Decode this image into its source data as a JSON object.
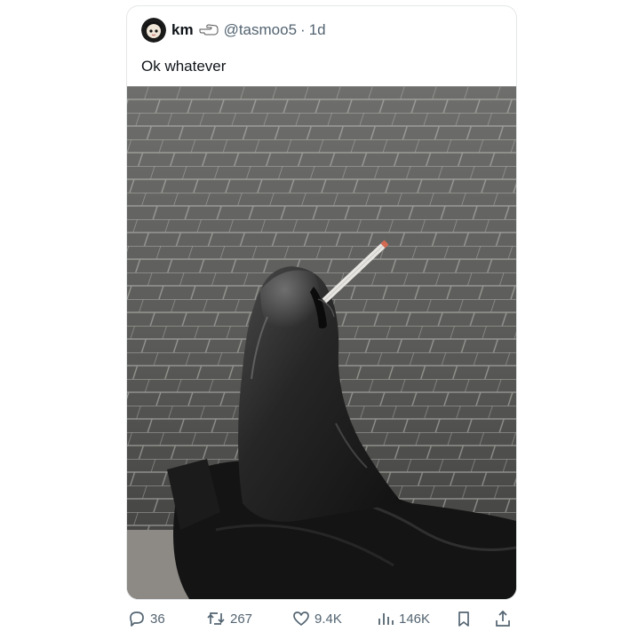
{
  "tweet": {
    "display_name": "km",
    "handle": "@tasmoo5",
    "separator": "·",
    "time": "1d",
    "text": "Ok whatever",
    "photo_icon": "photo-leather-boot-with-cigarette"
  },
  "actions": {
    "replies": "36",
    "reposts": "267",
    "likes": "9.4K",
    "views": "146K",
    "reply_icon": "reply-icon",
    "repost_icon": "repost-icon",
    "like_icon": "heart-icon",
    "views_icon": "views-icon",
    "bookmark_icon": "bookmark-icon",
    "share_icon": "share-icon"
  },
  "colors": {
    "text": "#0f1419",
    "muted": "#536471",
    "border": "#e3e6e8"
  }
}
